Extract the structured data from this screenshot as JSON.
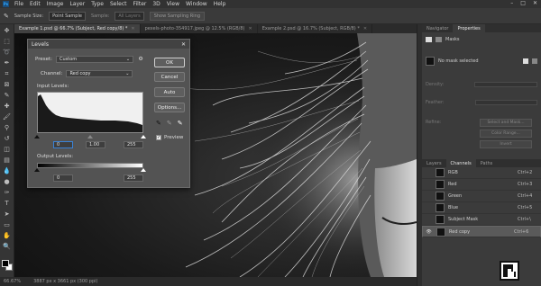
{
  "menubar": {
    "logo": "Ps",
    "items": [
      "File",
      "Edit",
      "Image",
      "Layer",
      "Type",
      "Select",
      "Filter",
      "3D",
      "View",
      "Window",
      "Help"
    ],
    "controls": [
      "–",
      "□",
      "✕"
    ]
  },
  "options_bar": {
    "sample_size_label": "Sample Size:",
    "sample_size_value": "Point Sample",
    "sample_label": "Sample:",
    "sample_value": "All Layers",
    "show_ring": "Show Sampling Ring"
  },
  "doc_tabs": [
    {
      "label": "Example 1.psd @ 66.7% (Subject, Red copy/8) *",
      "active": true
    },
    {
      "label": "pexels-photo-354917.jpeg @ 12.5% (RGB/8)",
      "active": false
    },
    {
      "label": "Example 2.psd @ 16.7% (Subject, RGB/8) *",
      "active": false
    }
  ],
  "status_bar": {
    "zoom": "66.67%",
    "doc_info": "3887 px x 3661 px (300 ppi)"
  },
  "levels_dialog": {
    "title": "Levels",
    "close": "✕",
    "preset_label": "Preset:",
    "preset_value": "Custom",
    "channel_label": "Channel:",
    "channel_value": "Red copy",
    "input_label": "Input Levels:",
    "input_black": "0",
    "input_gamma": "1.00",
    "input_white": "255",
    "output_label": "Output Levels:",
    "output_black": "0",
    "output_white": "255",
    "buttons": {
      "ok": "OK",
      "cancel": "Cancel",
      "auto": "Auto",
      "options": "Options..."
    },
    "preview_label": "Preview",
    "preview_checked": "✓"
  },
  "properties_panel": {
    "tabs": [
      "Navigator",
      "Properties"
    ],
    "section": "Masks",
    "no_mask": "No mask selected",
    "density_label": "Density:",
    "feather_label": "Feather:",
    "refine_label": "Refine:",
    "select_mask_btn": "Select and Mask...",
    "color_range_btn": "Color Range...",
    "invert_btn": "Invert"
  },
  "channels_panel": {
    "tabs": [
      "Layers",
      "Channels",
      "Paths"
    ],
    "active_tab": "Channels",
    "rows": [
      {
        "name": "RGB",
        "shortcut": "Ctrl+2",
        "visible": "",
        "selected": false
      },
      {
        "name": "Red",
        "shortcut": "Ctrl+3",
        "visible": "",
        "selected": false
      },
      {
        "name": "Green",
        "shortcut": "Ctrl+4",
        "visible": "",
        "selected": false
      },
      {
        "name": "Blue",
        "shortcut": "Ctrl+5",
        "visible": "",
        "selected": false
      },
      {
        "name": "Subject Mask",
        "shortcut": "Ctrl+\\",
        "visible": "",
        "selected": false
      },
      {
        "name": "Red copy",
        "shortcut": "Ctrl+6",
        "visible": "👁",
        "selected": true
      }
    ]
  },
  "colors": {
    "accent": "#3a82d6",
    "panel": "#3b3b3b",
    "dialog": "#535353"
  }
}
